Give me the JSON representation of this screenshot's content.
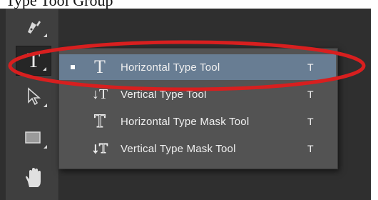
{
  "caption": "Type Tool Group",
  "toolbar": {
    "tools": [
      {
        "icon": "pen-tool-icon"
      },
      {
        "icon": "type-tool-icon",
        "glyph": "T"
      },
      {
        "icon": "path-selection-icon"
      },
      {
        "icon": "rectangle-tool-icon"
      },
      {
        "icon": "hand-tool-icon"
      }
    ]
  },
  "flyout": {
    "items": [
      {
        "label": "Horizontal Type Tool",
        "shortcut": "T",
        "selected": true,
        "icon": "horizontal-type-icon",
        "glyph": "T"
      },
      {
        "label": "Vertical Type Tool",
        "shortcut": "T",
        "selected": false,
        "icon": "vertical-type-icon",
        "glyph": "↓T"
      },
      {
        "label": "Horizontal Type Mask Tool",
        "shortcut": "T",
        "selected": false,
        "icon": "horizontal-type-mask-icon",
        "glyph": "T"
      },
      {
        "label": "Vertical Type Mask Tool",
        "shortcut": "T",
        "selected": false,
        "icon": "vertical-type-mask-icon",
        "glyph": "↓T"
      }
    ]
  },
  "colors": {
    "highlight": "#687d93",
    "annotation": "#d81f1f",
    "panel": "#535353",
    "toolbar": "#3f3f3f"
  }
}
